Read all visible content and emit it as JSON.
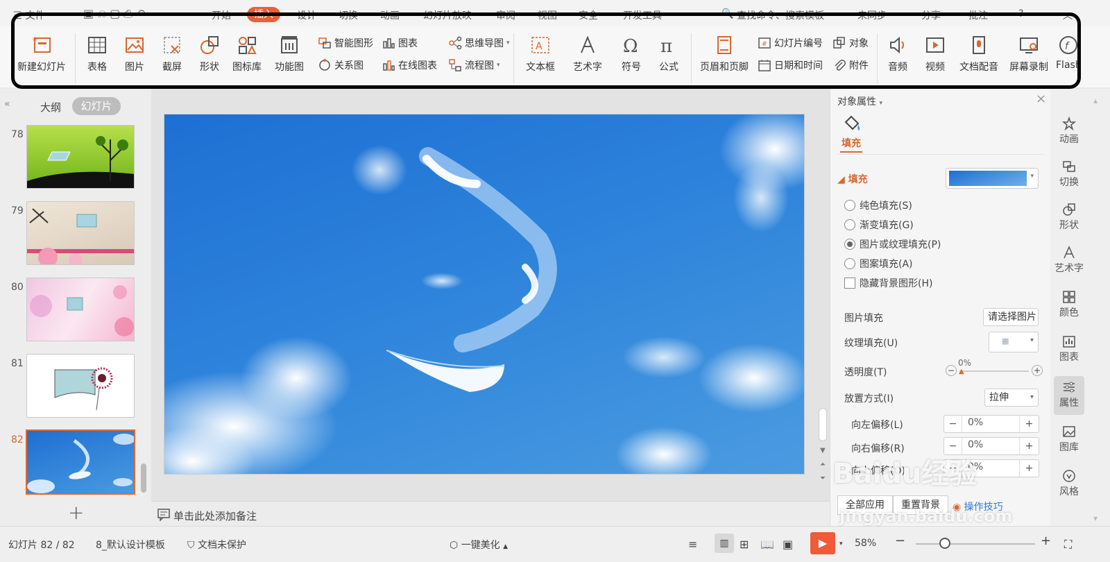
{
  "menu": {
    "file": "三 文件",
    "items": [
      "开始",
      "插入",
      "设计",
      "切换",
      "动画",
      "幻灯片放映",
      "审阅",
      "视图",
      "安全",
      "开发工具"
    ],
    "active": "插入",
    "search": "查找命令、搜索模板",
    "sync": "未同步",
    "share": "分享",
    "comment": "批注"
  },
  "ribbon": {
    "new_slide": "新建幻灯片",
    "table": "表格",
    "picture": "图片",
    "screenshot": "截屏",
    "shape": "形状",
    "icon_lib": "图标库",
    "func_chart": "功能图",
    "smart_art": "智能图形",
    "chart": "图表",
    "relation": "关系图",
    "online_chart": "在线图表",
    "mindmap": "思维导图",
    "flowchart": "流程图",
    "textbox": "文本框",
    "wordart": "艺术字",
    "symbol": "符号",
    "formula": "公式",
    "header_footer": "页眉和页脚",
    "slide_num": "幻灯片编号",
    "object": "对象",
    "datetime": "日期和时间",
    "attachment": "附件",
    "audio": "音频",
    "video": "视频",
    "doc_dub": "文档配音",
    "screen_rec": "屏幕录制",
    "flash": "Flash"
  },
  "left_panel": {
    "tab_outline": "大纲",
    "tab_slides": "幻灯片",
    "slides": [
      {
        "num": "78"
      },
      {
        "num": "79"
      },
      {
        "num": "80"
      },
      {
        "num": "81"
      },
      {
        "num": "82",
        "selected": true
      }
    ]
  },
  "notes_placeholder": "单击此处添加备注",
  "props": {
    "title": "对象属性",
    "tab": "填充",
    "section": "填充",
    "options": [
      "纯色填充(S)",
      "渐变填充(G)",
      "图片或纹理填充(P)",
      "图案填充(A)"
    ],
    "selected_option": "图片或纹理填充(P)",
    "hide_bg": "隐藏背景图形(H)",
    "pic_fill_label": "图片填充",
    "pic_fill_value": "请选择图片",
    "texture_label": "纹理填充(U)",
    "transparency_label": "透明度(T)",
    "transparency_value": "0%",
    "placement_label": "放置方式(I)",
    "placement_value": "拉伸",
    "offset_left_label": "向左偏移(L)",
    "offset_left": "0%",
    "offset_right_label": "向右偏移(R)",
    "offset_right": "0%",
    "offset_up_label": "向上偏移(O)",
    "offset_up": "0%",
    "apply_all": "全部应用",
    "reset_bg": "重置背景",
    "tips": "操作技巧"
  },
  "right_bar": [
    "动画",
    "切换",
    "形状",
    "艺术字",
    "颜色",
    "图表",
    "属性",
    "图库",
    "风格"
  ],
  "right_bar_active": "属性",
  "status": {
    "slide_count": "幻灯片 82 / 82",
    "template": "8_默认设计模板",
    "protect": "文档未保护",
    "beautify": "一键美化",
    "zoom": "58%"
  },
  "watermark": {
    "brand": "Baidu经验",
    "url": "jingyan.baidu.com"
  },
  "colors": {
    "accent": "#e8603a",
    "sky": "#2d83db",
    "play": "#f05a3a"
  }
}
